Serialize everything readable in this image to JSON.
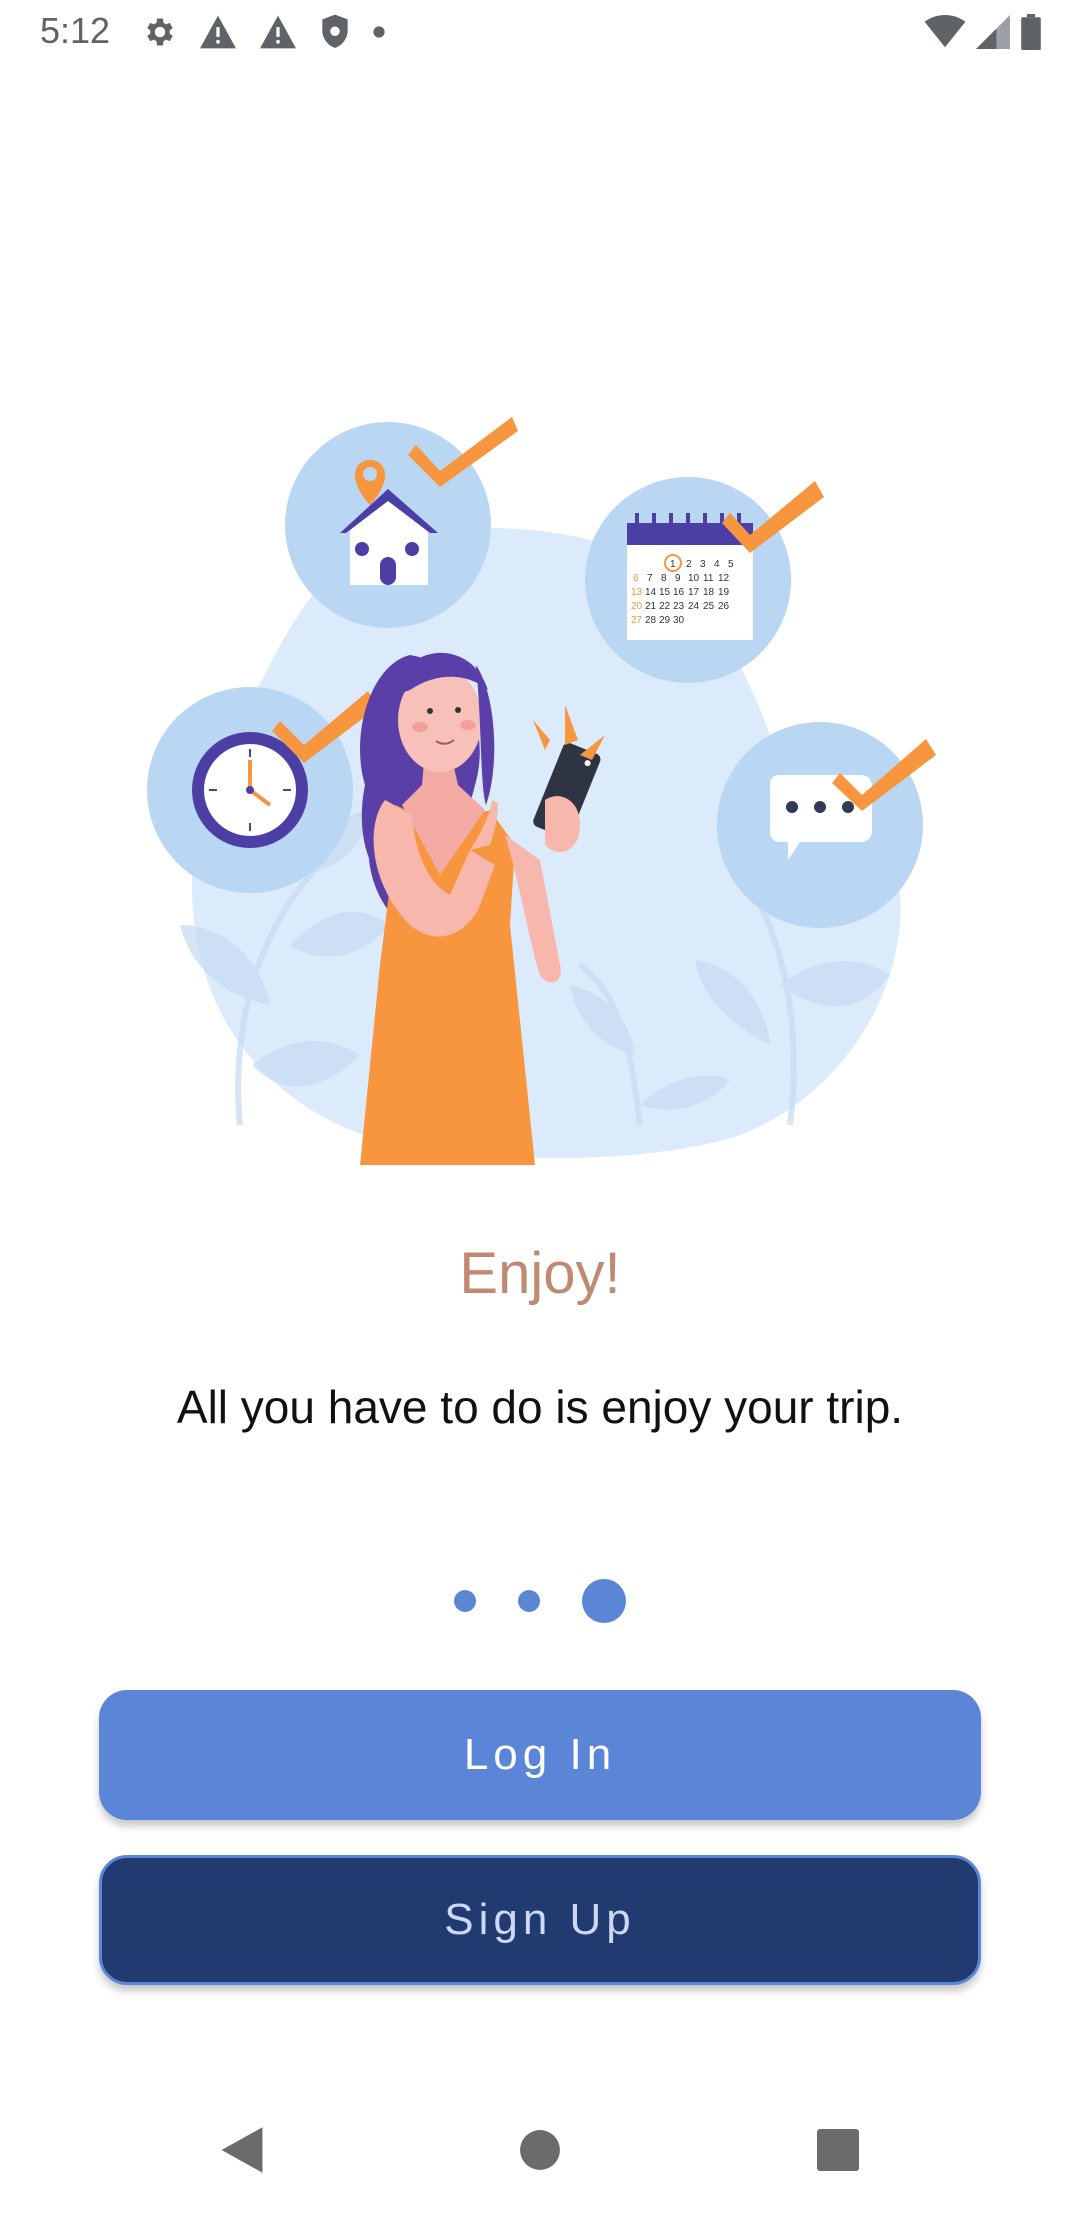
{
  "status_bar": {
    "time": "5:12",
    "icons_left": [
      "gear-icon",
      "warning-icon",
      "warning-icon",
      "shield-icon",
      "dot-icon"
    ],
    "icons_right": [
      "wifi-icon",
      "signal-icon",
      "battery-icon"
    ]
  },
  "onboarding": {
    "title": "Enjoy!",
    "subtitle": "All you have to do is enjoy your trip.",
    "page_count": 3,
    "active_page": 3,
    "illustration": "woman-holding-phone-with-checklist-icons"
  },
  "buttons": {
    "login_label": "Log In",
    "signup_label": "Sign Up"
  },
  "nav_bar": {
    "icons": [
      "back-icon",
      "home-icon",
      "recents-icon"
    ]
  },
  "colors": {
    "accent": "#5b86d8",
    "signup_bg": "#213a70",
    "title": "#c08a72",
    "orange": "#f7963f",
    "light_blue": "#dcebfb",
    "circle_blue": "#b9d6f3",
    "purple": "#4b3fa6"
  },
  "calendar": {
    "rows": [
      [
        "1",
        "2",
        "3",
        "4",
        "5"
      ],
      [
        "6",
        "7",
        "8",
        "9",
        "10",
        "11",
        "12"
      ],
      [
        "13",
        "14",
        "15",
        "16",
        "17",
        "18",
        "19"
      ],
      [
        "20",
        "21",
        "22",
        "23",
        "24",
        "25",
        "26"
      ],
      [
        "27",
        "28",
        "29",
        "30"
      ]
    ]
  }
}
